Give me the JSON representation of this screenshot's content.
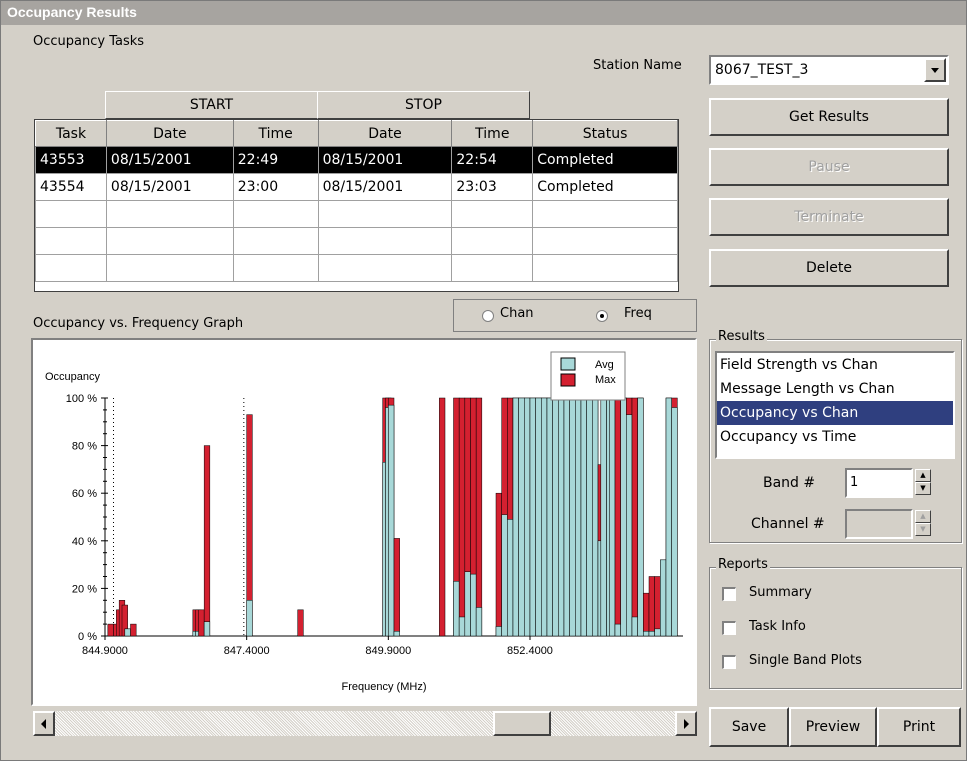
{
  "window": {
    "title": "Occupancy Results"
  },
  "tasks_section": {
    "label": "Occupancy Tasks",
    "group_start": "START",
    "group_stop": "STOP",
    "columns": [
      "Task",
      "Date",
      "Time",
      "Date",
      "Time",
      "Status"
    ],
    "rows": [
      [
        "43553",
        "08/15/2001",
        "22:49",
        "08/15/2001",
        "22:54",
        "Completed"
      ],
      [
        "43554",
        "08/15/2001",
        "23:00",
        "08/15/2001",
        "23:03",
        "Completed"
      ],
      [
        "",
        "",
        "",
        "",
        "",
        ""
      ],
      [
        "",
        "",
        "",
        "",
        "",
        ""
      ],
      [
        "",
        "",
        "",
        "",
        "",
        ""
      ]
    ]
  },
  "station": {
    "label": "Station Name",
    "value": "8067_TEST_3"
  },
  "buttons": {
    "get_results": "Get Results",
    "pause": "Pause",
    "terminate": "Terminate",
    "delete": "Delete",
    "save": "Save",
    "preview": "Preview",
    "print": "Print"
  },
  "graph": {
    "label": "Occupancy vs. Frequency Graph",
    "radio_chan": "Chan",
    "radio_freq": "Freq",
    "selected": "Freq"
  },
  "results": {
    "label": "Results",
    "items": [
      "Field Strength vs Chan",
      "Message Length vs Chan",
      "Occupancy vs Chan",
      "Occupancy vs Time"
    ],
    "selected_index": 2,
    "band_label": "Band #",
    "band_value": "1",
    "channel_label": "Channel #",
    "channel_value": ""
  },
  "reports": {
    "label": "Reports",
    "items": [
      "Summary",
      "Task Info",
      "Single Band Plots"
    ]
  },
  "colors": {
    "avg": "#a8d8d8",
    "max": "#d42030",
    "selection": "#2f3f7f"
  },
  "chart_data": {
    "type": "bar",
    "ylabel": "Occupancy",
    "xlabel": "Frequency (MHz)",
    "x_ticks": [
      "844.9000",
      "847.4000",
      "849.9000",
      "852.4000"
    ],
    "y_ticks": [
      "0 %",
      "20 %",
      "40 %",
      "60 %",
      "80 %",
      "100 %"
    ],
    "ylim": [
      0,
      100
    ],
    "xlim": [
      844.9,
      855.1
    ],
    "legend": [
      "Avg",
      "Max"
    ],
    "legend_position": "top-right",
    "series": [
      {
        "name": "Avg",
        "x": [
          845.0,
          845.1,
          845.15,
          845.2,
          845.25,
          845.3,
          845.4,
          846.5,
          846.55,
          846.6,
          846.7,
          847.45,
          848.35,
          849.85,
          849.9,
          849.95,
          850.05,
          850.85,
          851.1,
          851.2,
          851.3,
          851.4,
          851.5,
          851.85,
          851.95,
          852.05,
          852.15,
          852.25,
          852.35,
          852.45,
          852.55,
          852.65,
          852.75,
          852.85,
          852.95,
          853.05,
          853.15,
          853.25,
          853.35,
          853.45,
          853.55,
          853.65,
          853.7,
          853.8,
          853.85,
          853.95,
          854.05,
          854.15,
          854.25,
          854.35,
          854.45,
          854.55,
          854.65,
          854.75,
          854.85,
          854.95
        ],
        "values": [
          0,
          0,
          0,
          0,
          0,
          3,
          0,
          2,
          2,
          0,
          6,
          15,
          0,
          73,
          96,
          97,
          2,
          0,
          23,
          8,
          27,
          26,
          12,
          4,
          51,
          49,
          100,
          100,
          100,
          100,
          100,
          100,
          100,
          100,
          100,
          100,
          100,
          100,
          100,
          100,
          100,
          40,
          100,
          100,
          100,
          5,
          100,
          93,
          8,
          100,
          2,
          2,
          3,
          32,
          100,
          96
        ]
      },
      {
        "name": "Max",
        "x": [
          845.0,
          845.1,
          845.15,
          845.2,
          845.25,
          845.3,
          845.4,
          846.5,
          846.55,
          846.6,
          846.7,
          847.45,
          848.35,
          849.85,
          849.9,
          849.95,
          850.05,
          850.85,
          851.1,
          851.2,
          851.3,
          851.4,
          851.5,
          851.85,
          851.95,
          852.05,
          852.15,
          852.25,
          852.35,
          852.45,
          852.55,
          852.65,
          852.75,
          852.85,
          852.95,
          853.05,
          853.15,
          853.25,
          853.35,
          853.45,
          853.55,
          853.65,
          853.7,
          853.8,
          853.85,
          853.95,
          854.05,
          854.15,
          854.25,
          854.35,
          854.45,
          854.55,
          854.65,
          854.75,
          854.85,
          854.95
        ],
        "values": [
          5,
          5,
          11,
          15,
          13,
          3,
          5,
          11,
          11,
          11,
          80,
          93,
          11,
          100,
          100,
          100,
          41,
          100,
          100,
          100,
          100,
          100,
          100,
          60,
          100,
          100,
          100,
          100,
          100,
          100,
          100,
          100,
          100,
          100,
          100,
          100,
          100,
          100,
          100,
          100,
          100,
          72,
          100,
          100,
          100,
          100,
          100,
          100,
          100,
          100,
          18,
          25,
          25,
          32,
          100,
          100
        ]
      }
    ]
  }
}
